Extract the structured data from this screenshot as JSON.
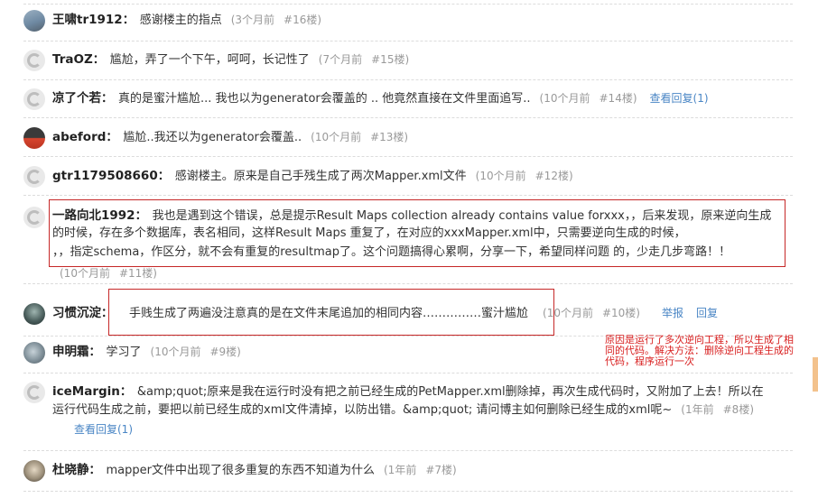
{
  "comments": [
    {
      "user": "王啸tr1912",
      "text": "感谢楼主的指点",
      "time": "(3个月前",
      "floor": "#16楼)"
    },
    {
      "user": "TraOZ",
      "text": "尴尬，弄了一个下午，呵呵，长记性了",
      "time": "(7个月前",
      "floor": "#15楼)"
    },
    {
      "user": "凉了个若",
      "text": "真的是蜜汁尴尬... 我也以为generator会覆盖的 .. 他竟然直接在文件里面追写..",
      "time": "(10个月前",
      "floor": "#14楼)",
      "reply_link": "查看回复(1)"
    },
    {
      "user": "abeford",
      "text": "尴尬..我还以为generator会覆盖..",
      "time": "(10个月前",
      "floor": "#13楼)"
    },
    {
      "user": "gtr1179508660",
      "text": "感谢楼主。原来是自己手残生成了两次Mapper.xml文件",
      "time": "(10个月前",
      "floor": "#12楼)"
    },
    {
      "user": "一路向北1992",
      "text_line1": "我也是遇到这个错误，总是提示Result Maps collection already contains value forxxx，，后来发现，原来逆向生成",
      "text_line2": "的时候，存在多个数据库，表名相同，这样Result Maps 重复了，在对应的xxxMapper.xml中，只需要逆向生成的时候，",
      "text_line3": "，，指定schema，作区分，就不会有重复的resultmap了。这个问题搞得心累啊，分享一下，希望同样问题 的，少走几步弯路！！",
      "time": "(10个月前",
      "floor": "#11楼)"
    },
    {
      "user": "习惯沉淀",
      "text": "手贱生成了两遍没注意真的是在文件末尾追加的相同内容……………蜜汁尴尬",
      "time": "(10个月前",
      "floor": "#10楼)",
      "report": "举报",
      "reply": "回复"
    },
    {
      "user": "申明霜",
      "text": "学习了",
      "time": "(10个月前",
      "floor": "#9楼)"
    },
    {
      "user": "iceMargin",
      "text_line1": "&amp;quot;原来是我在运行时没有把之前已经生成的PetMapper.xml删除掉，再次生成代码时，又附加了上去！所以在",
      "text_line2": "运行代码生成之前，要把以前已经生成的xml文件清掉，以防出错。&amp;quot; 请问博主如何删除已经生成的xml呢~",
      "time": "(1年前",
      "floor": "#8楼)",
      "reply_link": "查看回复(1)"
    },
    {
      "user": "杜晓静",
      "text": "mapper文件中出现了很多重复的东西不知道为什么",
      "time": "(1年前",
      "floor": "#7楼)"
    }
  ],
  "annotation": {
    "line1": "原因是运行了多次逆向工程，所以生成了相",
    "line2": "同的代码。解决方法：删除逆向工程生成的",
    "line3": "代码，程序运行一次"
  },
  "colors": {
    "red_box": "#c62828",
    "annotation_text": "#d81e1e",
    "link": "#4a86c5",
    "meta": "#999999"
  },
  "separator": "："
}
